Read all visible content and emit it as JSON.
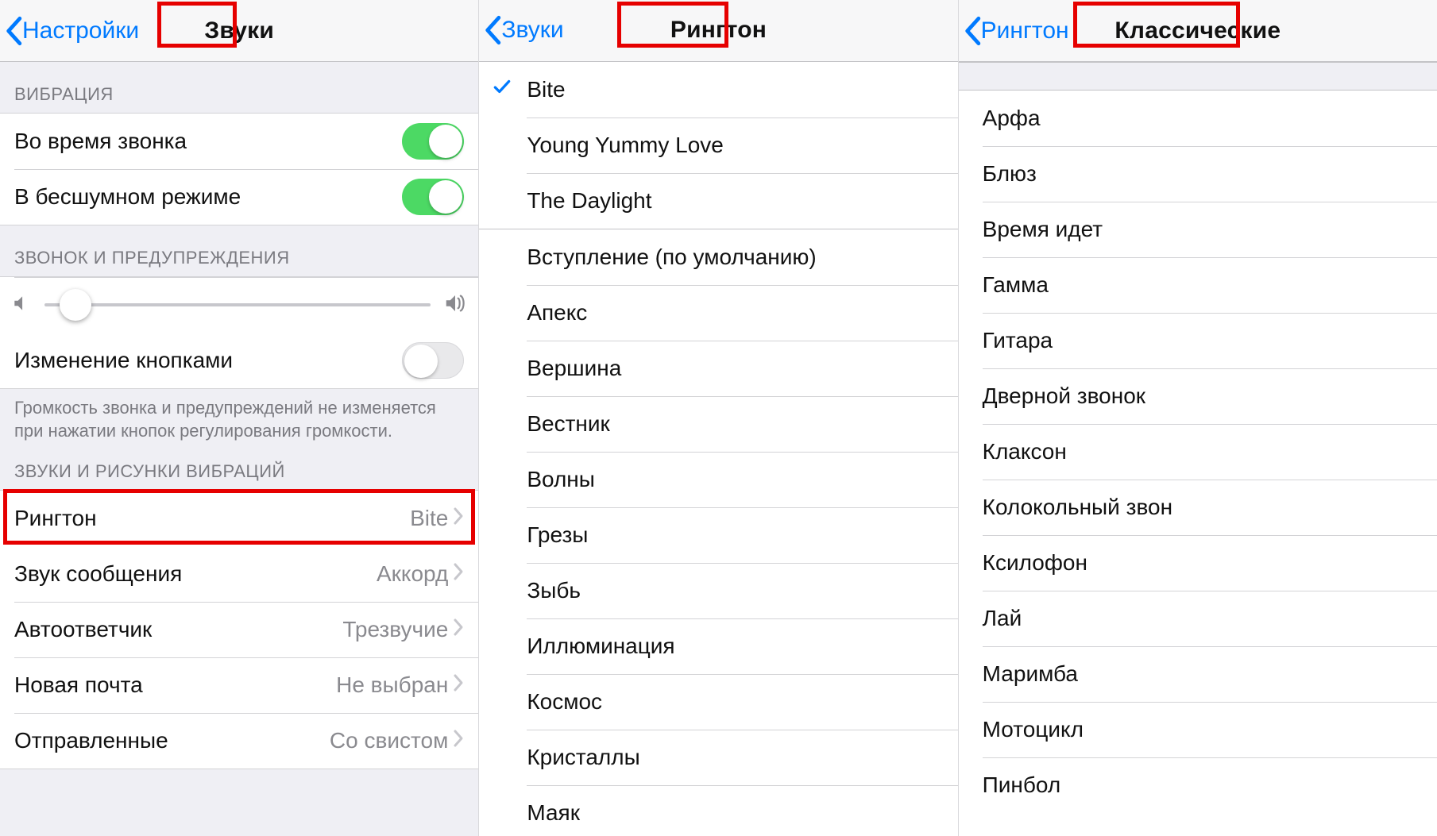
{
  "colors": {
    "ios_blue": "#007aff",
    "ios_green": "#4cd964",
    "highlight_red": "#e60000"
  },
  "pane1": {
    "back_label": "Настройки",
    "title": "Звуки",
    "sections": {
      "vibration_header": "ВИБРАЦИЯ",
      "vibrate_on_ring": "Во время звонка",
      "vibrate_on_silent": "В бесшумном режиме",
      "ringer_header": "ЗВОНОК И ПРЕДУПРЕЖДЕНИЯ",
      "change_with_buttons": "Изменение кнопками",
      "ringer_footer": "Громкость звонка и предупреждений не изменяется при нажатии кнопок регулирования громкости.",
      "sounds_header": "ЗВУКИ И РИСУНКИ ВИБРАЦИЙ"
    },
    "sound_rows": [
      {
        "label": "Рингтон",
        "value": "Bite",
        "highlight": true
      },
      {
        "label": "Звук сообщения",
        "value": "Аккорд",
        "highlight": false
      },
      {
        "label": "Автоответчик",
        "value": "Трезвучие",
        "highlight": false
      },
      {
        "label": "Новая почта",
        "value": "Не выбран",
        "highlight": false
      },
      {
        "label": "Отправленные",
        "value": "Со свистом",
        "highlight": false
      }
    ],
    "toggles": {
      "vibrate_on_ring": true,
      "vibrate_on_silent": true,
      "change_with_buttons": false
    },
    "slider_pct": 4
  },
  "pane2": {
    "back_label": "Звуки",
    "title": "Рингтон",
    "custom_tones": [
      {
        "label": "Bite",
        "selected": true
      },
      {
        "label": "Young Yummy Love",
        "selected": false
      },
      {
        "label": "The Daylight",
        "selected": false
      }
    ],
    "builtin_tones": [
      "Вступление (по умолчанию)",
      "Апекс",
      "Вершина",
      "Вестник",
      "Волны",
      "Грезы",
      "Зыбь",
      "Иллюминация",
      "Космос",
      "Кристаллы",
      "Маяк"
    ]
  },
  "pane3": {
    "back_label": "Рингтон",
    "title": "Классические",
    "classic_tones": [
      "Арфа",
      "Блюз",
      "Время идет",
      "Гамма",
      "Гитара",
      "Дверной звонок",
      "Клаксон",
      "Колокольный звон",
      "Ксилофон",
      "Лай",
      "Маримба",
      "Мотоцикл",
      "Пинбол"
    ]
  }
}
